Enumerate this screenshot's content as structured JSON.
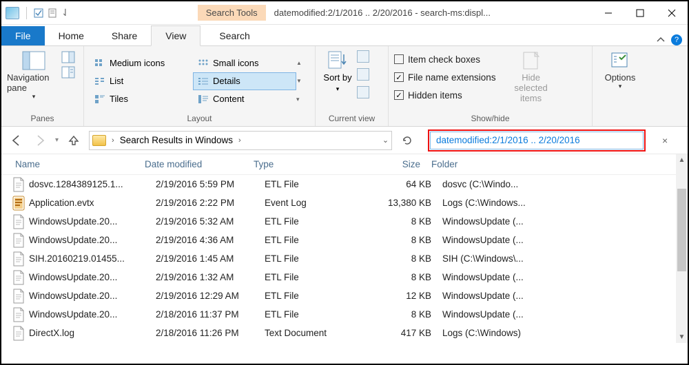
{
  "title": "datemodified:2/1/2016 .. 2/20/2016 - search-ms:displ...",
  "tools_label": "Search Tools",
  "tabs": {
    "file": "File",
    "home": "Home",
    "share": "Share",
    "view": "View",
    "search": "Search"
  },
  "ribbon": {
    "panes": {
      "nav": "Navigation pane",
      "group": "Panes"
    },
    "layout": {
      "medium": "Medium icons",
      "small": "Small icons",
      "list": "List",
      "details": "Details",
      "tiles": "Tiles",
      "content": "Content",
      "group": "Layout"
    },
    "current": {
      "sort": "Sort by",
      "group": "Current view"
    },
    "show": {
      "cb": "Item check boxes",
      "ext": "File name extensions",
      "hidden": "Hidden items",
      "hidesel": "Hide selected items",
      "group": "Show/hide"
    },
    "options": "Options"
  },
  "breadcrumb": {
    "label": "Search Results in Windows"
  },
  "search": {
    "query": "datemodified:2/1/2016 .. 2/20/2016"
  },
  "columns": {
    "name": "Name",
    "date": "Date modified",
    "type": "Type",
    "size": "Size",
    "folder": "Folder"
  },
  "files": [
    {
      "icon": "text",
      "name": "dosvc.1284389125.1...",
      "date": "2/19/2016 5:59 PM",
      "type": "ETL File",
      "size": "64 KB",
      "folder": "dosvc (C:\\Windo..."
    },
    {
      "icon": "evtx",
      "name": "Application.evtx",
      "date": "2/19/2016 2:22 PM",
      "type": "Event Log",
      "size": "13,380 KB",
      "folder": "Logs (C:\\Windows..."
    },
    {
      "icon": "text",
      "name": "WindowsUpdate.20...",
      "date": "2/19/2016 5:32 AM",
      "type": "ETL File",
      "size": "8 KB",
      "folder": "WindowsUpdate (..."
    },
    {
      "icon": "text",
      "name": "WindowsUpdate.20...",
      "date": "2/19/2016 4:36 AM",
      "type": "ETL File",
      "size": "8 KB",
      "folder": "WindowsUpdate (..."
    },
    {
      "icon": "text",
      "name": "SIH.20160219.01455...",
      "date": "2/19/2016 1:45 AM",
      "type": "ETL File",
      "size": "8 KB",
      "folder": "SIH (C:\\Windows\\..."
    },
    {
      "icon": "text",
      "name": "WindowsUpdate.20...",
      "date": "2/19/2016 1:32 AM",
      "type": "ETL File",
      "size": "8 KB",
      "folder": "WindowsUpdate (..."
    },
    {
      "icon": "text",
      "name": "WindowsUpdate.20...",
      "date": "2/19/2016 12:29 AM",
      "type": "ETL File",
      "size": "12 KB",
      "folder": "WindowsUpdate (..."
    },
    {
      "icon": "text",
      "name": "WindowsUpdate.20...",
      "date": "2/18/2016 11:37 PM",
      "type": "ETL File",
      "size": "8 KB",
      "folder": "WindowsUpdate (..."
    },
    {
      "icon": "text",
      "name": "DirectX.log",
      "date": "2/18/2016 11:26 PM",
      "type": "Text Document",
      "size": "417 KB",
      "folder": "Logs (C:\\Windows)"
    }
  ]
}
